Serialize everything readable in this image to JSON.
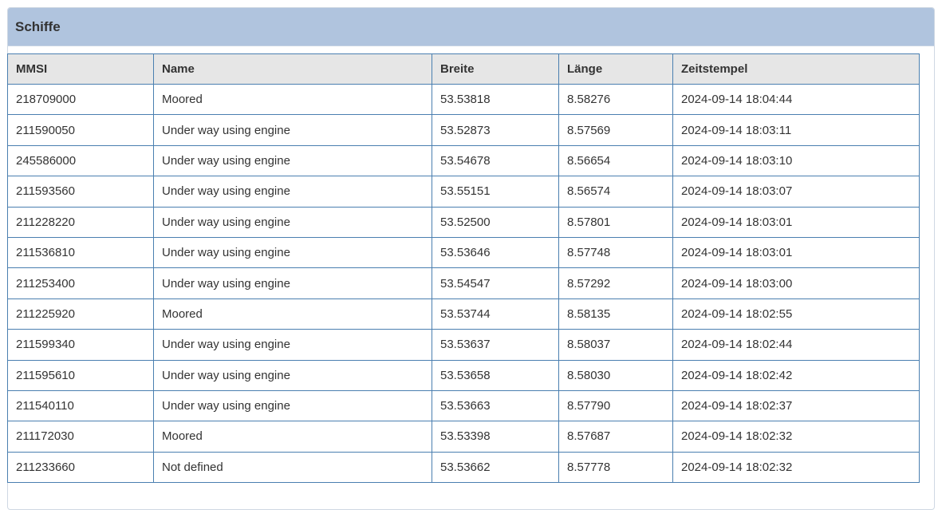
{
  "panel": {
    "title": "Schiffe"
  },
  "table": {
    "columns": [
      "MMSI",
      "Name",
      "Breite",
      "Länge",
      "Zeitstempel"
    ],
    "rows": [
      [
        "218709000",
        "Moored",
        "53.53818",
        "8.58276",
        "2024-09-14 18:04:44"
      ],
      [
        "211590050",
        "Under way using engine",
        "53.52873",
        "8.57569",
        "2024-09-14 18:03:11"
      ],
      [
        "245586000",
        "Under way using engine",
        "53.54678",
        "8.56654",
        "2024-09-14 18:03:10"
      ],
      [
        "211593560",
        "Under way using engine",
        "53.55151",
        "8.56574",
        "2024-09-14 18:03:07"
      ],
      [
        "211228220",
        "Under way using engine",
        "53.52500",
        "8.57801",
        "2024-09-14 18:03:01"
      ],
      [
        "211536810",
        "Under way using engine",
        "53.53646",
        "8.57748",
        "2024-09-14 18:03:01"
      ],
      [
        "211253400",
        "Under way using engine",
        "53.54547",
        "8.57292",
        "2024-09-14 18:03:00"
      ],
      [
        "211225920",
        "Moored",
        "53.53744",
        "8.58135",
        "2024-09-14 18:02:55"
      ],
      [
        "211599340",
        "Under way using engine",
        "53.53637",
        "8.58037",
        "2024-09-14 18:02:44"
      ],
      [
        "211595610",
        "Under way using engine",
        "53.53658",
        "8.58030",
        "2024-09-14 18:02:42"
      ],
      [
        "211540110",
        "Under way using engine",
        "53.53663",
        "8.57790",
        "2024-09-14 18:02:37"
      ],
      [
        "211172030",
        "Moored",
        "53.53398",
        "8.57687",
        "2024-09-14 18:02:32"
      ],
      [
        "211233660",
        "Not defined",
        "53.53662",
        "8.57778",
        "2024-09-14 18:02:32"
      ]
    ]
  },
  "colors": {
    "header_background": "#b0c4de",
    "table_header_background": "#e6e6e6",
    "border": "#4a7fb0"
  }
}
